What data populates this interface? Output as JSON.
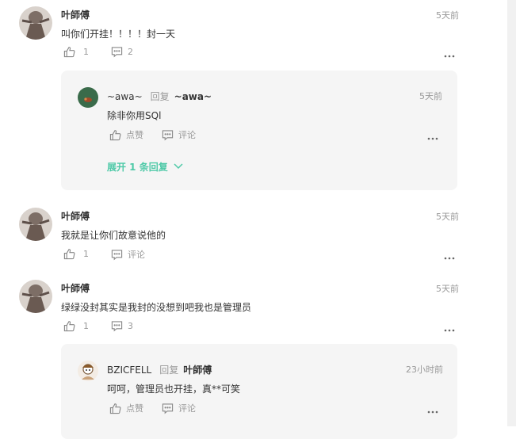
{
  "comments": [
    {
      "author": "叶師傅",
      "time": "5天前",
      "content": "叫你们开挂！！！！封一天",
      "likes": "1",
      "replies_count": "2",
      "replies": [
        {
          "author": "~awa~",
          "reply_label": "回复",
          "reply_to": "~awa~",
          "time": "5天前",
          "content": "除非你用SQl",
          "like_label": "点赞",
          "comment_label": "评论"
        }
      ],
      "expand_label": "展开 1 条回复"
    },
    {
      "author": "叶師傅",
      "time": "5天前",
      "content": "我就是让你们故意说他的",
      "likes": "1",
      "replies_count": "评论"
    },
    {
      "author": "叶師傅",
      "time": "5天前",
      "content": "绿绿没封其实是我封的没想到吧我也是管理员",
      "likes": "1",
      "replies_count": "3",
      "replies": [
        {
          "author": "BZICFELL",
          "reply_label": "回复",
          "reply_to": "叶師傅",
          "time": "23小时前",
          "content": "呵呵，管理员也开挂，真**可笑",
          "like_label": "点赞",
          "comment_label": "评论"
        }
      ]
    }
  ],
  "colors": {
    "accent": "#4ec9a7",
    "reply_bg": "#f5f5f5",
    "muted": "#999999",
    "text": "#333333"
  },
  "icons": [
    "thumbs-up-icon",
    "comment-icon",
    "more-icon",
    "chevron-down-icon"
  ]
}
